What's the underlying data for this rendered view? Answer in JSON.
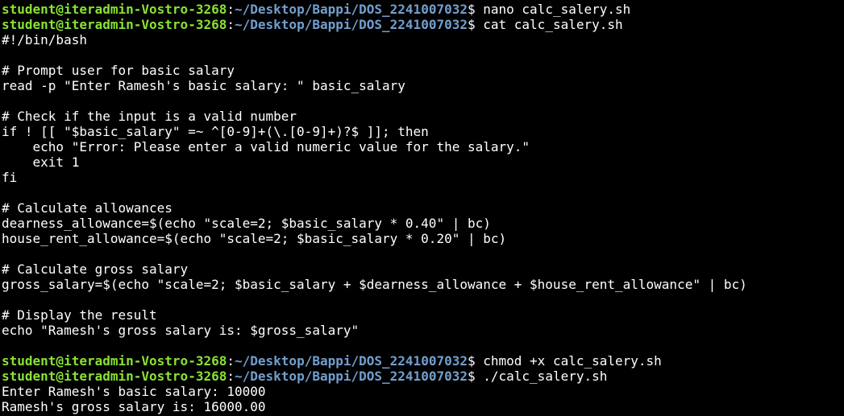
{
  "terminal": {
    "colors": {
      "background": "#000000",
      "text": "#ffffff",
      "user_host": "#8ae234",
      "path": "#729fcf"
    },
    "prompt": {
      "user_host": "student@iteradmin-Vostro-3268",
      "separator": ":",
      "path": "~/Desktop/Bappi/DOS_2241007032",
      "symbol": "$ "
    },
    "commands": [
      "nano calc_salery.sh",
      "cat calc_salery.sh",
      "chmod +x calc_salery.sh",
      "./calc_salery.sh"
    ],
    "script_lines": [
      "#!/bin/bash",
      "",
      "# Prompt user for basic salary",
      "read -p \"Enter Ramesh's basic salary: \" basic_salary",
      "",
      "# Check if the input is a valid number",
      "if ! [[ \"$basic_salary\" =~ ^[0-9]+(\\.[0-9]+)?$ ]]; then",
      "    echo \"Error: Please enter a valid numeric value for the salary.\"",
      "    exit 1",
      "fi",
      "",
      "# Calculate allowances",
      "dearness_allowance=$(echo \"scale=2; $basic_salary * 0.40\" | bc)",
      "house_rent_allowance=$(echo \"scale=2; $basic_salary * 0.20\" | bc)",
      "",
      "# Calculate gross salary",
      "gross_salary=$(echo \"scale=2; $basic_salary + $dearness_allowance + $house_rent_allowance\" | bc)",
      "",
      "# Display the result",
      "echo \"Ramesh's gross salary is: $gross_salary\"",
      ""
    ],
    "output_lines": [
      "Enter Ramesh's basic salary: 10000",
      "Ramesh's gross salary is: 16000.00"
    ]
  }
}
